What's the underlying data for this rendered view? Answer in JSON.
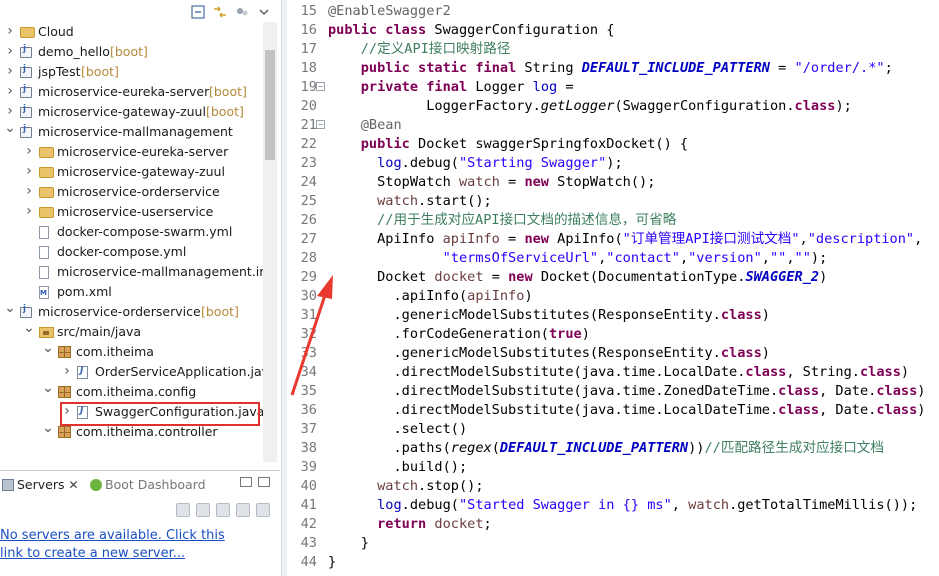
{
  "explorer": {
    "tree": [
      {
        "label": "Cloud",
        "suffix": "",
        "indent": 0,
        "arrow": ">",
        "icon": "folder"
      },
      {
        "label": "demo_hello",
        "suffix": " [boot]",
        "indent": 0,
        "arrow": ">",
        "icon": "project"
      },
      {
        "label": "jspTest",
        "suffix": " [boot]",
        "indent": 0,
        "arrow": ">",
        "icon": "project"
      },
      {
        "label": "microservice-eureka-server",
        "suffix": " [boot]",
        "indent": 0,
        "arrow": ">",
        "icon": "project"
      },
      {
        "label": "microservice-gateway-zuul",
        "suffix": " [boot]",
        "indent": 0,
        "arrow": ">",
        "icon": "project"
      },
      {
        "label": "microservice-mallmanagement",
        "suffix": "",
        "indent": 0,
        "arrow": "v",
        "icon": "project"
      },
      {
        "label": "microservice-eureka-server",
        "suffix": "",
        "indent": 1,
        "arrow": ">",
        "icon": "folder"
      },
      {
        "label": "microservice-gateway-zuul",
        "suffix": "",
        "indent": 1,
        "arrow": ">",
        "icon": "folder"
      },
      {
        "label": "microservice-orderservice",
        "suffix": "",
        "indent": 1,
        "arrow": ">",
        "icon": "folder"
      },
      {
        "label": "microservice-userservice",
        "suffix": "",
        "indent": 1,
        "arrow": ">",
        "icon": "folder"
      },
      {
        "label": "docker-compose-swarm.yml",
        "suffix": "",
        "indent": 1,
        "arrow": "",
        "icon": "file"
      },
      {
        "label": "docker-compose.yml",
        "suffix": "",
        "indent": 1,
        "arrow": "",
        "icon": "file"
      },
      {
        "label": "microservice-mallmanagement.iml",
        "suffix": "",
        "indent": 1,
        "arrow": "",
        "icon": "file"
      },
      {
        "label": "pom.xml",
        "suffix": "",
        "indent": 1,
        "arrow": "",
        "icon": "xml"
      },
      {
        "label": "microservice-orderservice",
        "suffix": " [boot]",
        "indent": 0,
        "arrow": "v",
        "icon": "project"
      },
      {
        "label": "src/main/java",
        "suffix": "",
        "indent": 1,
        "arrow": "v",
        "icon": "srcfolder"
      },
      {
        "label": "com.itheima",
        "suffix": "",
        "indent": 2,
        "arrow": "v",
        "icon": "package"
      },
      {
        "label": "OrderServiceApplication.java",
        "suffix": "",
        "indent": 3,
        "arrow": ">",
        "icon": "java"
      },
      {
        "label": "com.itheima.config",
        "suffix": "",
        "indent": 2,
        "arrow": "v",
        "icon": "package"
      },
      {
        "label": "SwaggerConfiguration.java",
        "suffix": "",
        "indent": 3,
        "arrow": ">",
        "icon": "java"
      },
      {
        "label": "com.itheima.controller",
        "suffix": "",
        "indent": 2,
        "arrow": "v",
        "icon": "package"
      }
    ]
  },
  "servers_panel": {
    "tab_servers": "Servers",
    "tab_close": "✕",
    "tab_boot": "Boot Dashboard",
    "no_servers_text": "No servers are available. Click this link to create a new server..."
  },
  "editor": {
    "lines": [
      {
        "n": "15",
        "fold": "",
        "html": "<span class=\"an\">@EnableSwagger2</span>"
      },
      {
        "n": "16",
        "fold": "",
        "html": "<span class=\"kw\">public class</span> SwaggerConfiguration {"
      },
      {
        "n": "17",
        "fold": "",
        "html": "    <span class=\"cm\">//定义API接口映射路径</span>"
      },
      {
        "n": "18",
        "fold": "",
        "html": "    <span class=\"kw\">public static final</span> String <span class=\"cs\">DEFAULT_INCLUDE_PATTERN</span> = <span class=\"st\">\"/order/.*\"</span>;"
      },
      {
        "n": "19",
        "fold": "−",
        "html": "    <span class=\"kw\">private final</span> Logger <span class=\"fd\">log</span> ="
      },
      {
        "n": "20",
        "fold": "",
        "html": "            LoggerFactory.<span class=\"it\">getLogger</span>(SwaggerConfiguration.<span class=\"kw\">class</span>);"
      },
      {
        "n": "21",
        "fold": "−",
        "html": "    <span class=\"an\">@Bean</span>"
      },
      {
        "n": "22",
        "fold": "",
        "html": "    <span class=\"kw\">public</span> Docket swaggerSpringfoxDocket() {"
      },
      {
        "n": "23",
        "fold": "",
        "html": "      <span class=\"fd\">log</span>.debug(<span class=\"st\">\"Starting Swagger\"</span>);"
      },
      {
        "n": "24",
        "fold": "",
        "html": "      StopWatch <span class=\"lv\">watch</span> = <span class=\"kw\">new</span> StopWatch();"
      },
      {
        "n": "25",
        "fold": "",
        "html": "      <span class=\"lv\">watch</span>.start();"
      },
      {
        "n": "26",
        "fold": "",
        "html": "      <span class=\"cm\">//用于生成对应API接口文档的描述信息，可省略</span>"
      },
      {
        "n": "27",
        "fold": "",
        "html": "      ApiInfo <span class=\"lv\">apiInfo</span> = <span class=\"kw\">new</span> ApiInfo(<span class=\"st\">\"订单管理API接口测试文档\"</span>,<span class=\"st\">\"description\"</span>,"
      },
      {
        "n": "28",
        "fold": "",
        "html": "              <span class=\"st\">\"termsOfServiceUrl\"</span>,<span class=\"st\">\"contact\"</span>,<span class=\"st\">\"version\"</span>,<span class=\"st\">\"\"</span>,<span class=\"st\">\"\"</span>);"
      },
      {
        "n": "29",
        "fold": "",
        "html": "      Docket <span class=\"lv\">docket</span> = <span class=\"kw\">new</span> Docket(DocumentationType.<span class=\"cs\">SWAGGER_2</span>)"
      },
      {
        "n": "30",
        "fold": "",
        "html": "        .apiInfo(<span class=\"lv\">apiInfo</span>)"
      },
      {
        "n": "31",
        "fold": "",
        "html": "        .genericModelSubstitutes(ResponseEntity.<span class=\"kw\">class</span>)"
      },
      {
        "n": "32",
        "fold": "",
        "html": "        .forCodeGeneration(<span class=\"kw\">true</span>)"
      },
      {
        "n": "33",
        "fold": "",
        "html": "        .genericModelSubstitutes(ResponseEntity.<span class=\"kw\">class</span>)"
      },
      {
        "n": "34",
        "fold": "",
        "html": "        .directModelSubstitute(java.time.LocalDate.<span class=\"kw\">class</span>, String.<span class=\"kw\">class</span>)"
      },
      {
        "n": "35",
        "fold": "",
        "html": "        .directModelSubstitute(java.time.ZonedDateTime.<span class=\"kw\">class</span>, Date.<span class=\"kw\">class</span>)"
      },
      {
        "n": "36",
        "fold": "",
        "html": "        .directModelSubstitute(java.time.LocalDateTime.<span class=\"kw\">class</span>, Date.<span class=\"kw\">class</span>)"
      },
      {
        "n": "37",
        "fold": "",
        "html": "        .select()"
      },
      {
        "n": "38",
        "fold": "",
        "html": "        .paths(<span class=\"it\">regex</span>(<span class=\"cs\">DEFAULT_INCLUDE_PATTERN</span>))<span class=\"cm\">//匹配路径生成对应接口文档</span>"
      },
      {
        "n": "39",
        "fold": "",
        "html": "        .build();"
      },
      {
        "n": "40",
        "fold": "",
        "html": "      <span class=\"lv\">watch</span>.stop();"
      },
      {
        "n": "41",
        "fold": "",
        "html": "      <span class=\"fd\">log</span>.debug(<span class=\"st\">\"Started Swagger in {} ms\"</span>, <span class=\"lv\">watch</span>.getTotalTimeMillis());"
      },
      {
        "n": "42",
        "fold": "",
        "html": "      <span class=\"kw\">return</span> <span class=\"lv\">docket</span>;"
      },
      {
        "n": "43",
        "fold": "",
        "html": "    }"
      },
      {
        "n": "44",
        "fold": "",
        "html": "}"
      }
    ]
  },
  "colors": {
    "keyword": "#7f0055",
    "string": "#2a00ff",
    "comment": "#3f7f5f",
    "constant": "#0000c0",
    "annotation": "#646464",
    "highlight_box": "#e0322c",
    "arrow": "#e8382f"
  }
}
